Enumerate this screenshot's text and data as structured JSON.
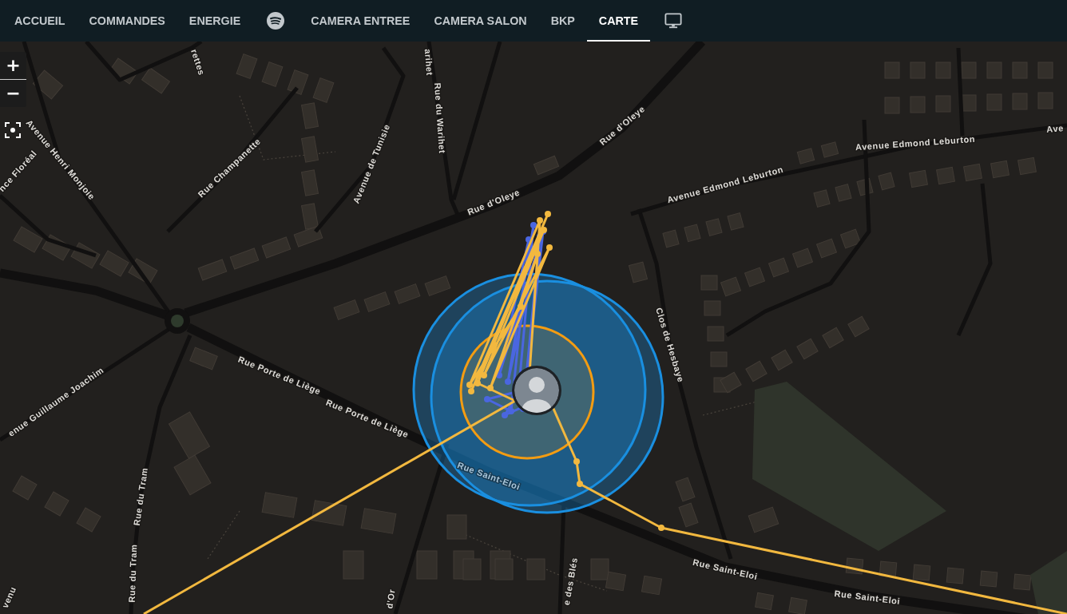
{
  "tabs": [
    {
      "kind": "text",
      "label": "ACCUEIL",
      "selected": false
    },
    {
      "kind": "text",
      "label": "COMMANDES",
      "selected": false
    },
    {
      "kind": "text",
      "label": "ENERGIE",
      "selected": false
    },
    {
      "kind": "media",
      "selected": false
    },
    {
      "kind": "text",
      "label": "CAMERA ENTREE",
      "selected": false
    },
    {
      "kind": "text",
      "label": "CAMERA SALON",
      "selected": false
    },
    {
      "kind": "text",
      "label": "BKP",
      "selected": false
    },
    {
      "kind": "text",
      "label": "CARTE",
      "selected": true
    },
    {
      "kind": "display",
      "selected": false
    }
  ],
  "map": {
    "controls": {
      "zoom_in": "+",
      "zoom_out": "−"
    },
    "street_labels": [
      "rettes",
      "arihet",
      "Rue du Warihet",
      "Rue d'Oleye",
      "Ave",
      "Avenue Edmond Leburton",
      "Avenue Henri Monjoie",
      "Rue Champanette",
      "nce Floréal",
      "Avenue de Tunisie",
      "Avenue Edmond Leburton",
      "Rue d'Oleye",
      "Clos de Hesbaye",
      "Rue Porte de Liège",
      "enue Guillaume Joachim",
      "Rue Porte de Liège",
      "Rue Saint-Eloi",
      "Rue du Tram",
      "Rue Saint-Eloi",
      "Rue du Tram",
      "e des Blés",
      "Rue Saint-Eloi",
      "d'Or",
      "venu"
    ],
    "zones": [
      {
        "color": "#1a8fe0"
      },
      {
        "color": "#1a8fe0"
      },
      {
        "color": "#f39c12"
      }
    ],
    "tracks": [
      {
        "color": "#4a66e0"
      },
      {
        "color": "#f2b83f"
      }
    ]
  }
}
